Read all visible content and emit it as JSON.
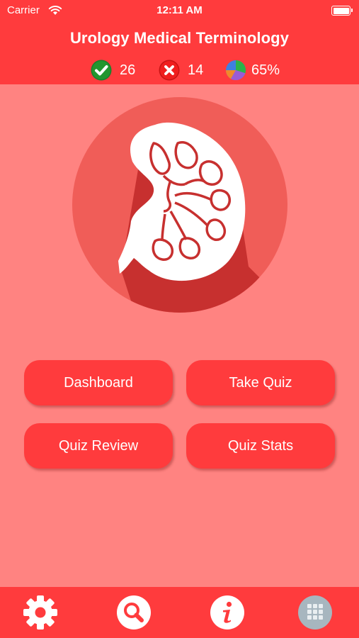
{
  "status_bar": {
    "carrier": "Carrier",
    "time": "12:11 AM"
  },
  "header": {
    "title": "Urology Medical Terminology",
    "stats": {
      "correct": "26",
      "incorrect": "14",
      "percent": "65%"
    }
  },
  "hero": {
    "icon": "kidney-icon"
  },
  "buttons": {
    "dashboard": "Dashboard",
    "take_quiz": "Take Quiz",
    "quiz_review": "Quiz Review",
    "quiz_stats": "Quiz Stats"
  },
  "tabbar": {
    "items": [
      "gear-icon",
      "search-icon",
      "info-icon",
      "apps-grid-icon"
    ]
  },
  "colors": {
    "brand_red": "#FF3B3D",
    "background": "#FF8381",
    "correct_green": "#1A7F2C",
    "incorrect_red": "#E02020"
  }
}
